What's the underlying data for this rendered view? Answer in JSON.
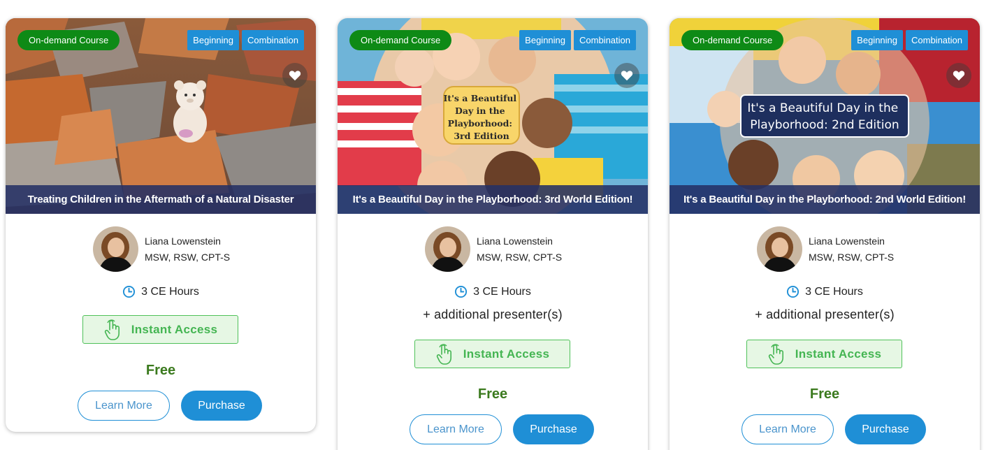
{
  "cards": [
    {
      "type_badge": "On-demand Course",
      "tags": [
        "Beginning",
        "Combination"
      ],
      "title": "Treating Children in the Aftermath of a Natural Disaster",
      "presenter_name": "Liana Lowenstein",
      "presenter_credentials": "MSW, RSW, CPT-S",
      "ce_hours": "3 CE Hours",
      "extra_presenters": "",
      "access_label": "Instant Access",
      "price": "Free",
      "learn_more_label": "Learn More",
      "purchase_label": "Purchase",
      "thumbnail_text": ""
    },
    {
      "type_badge": "On-demand Course",
      "tags": [
        "Beginning",
        "Combination"
      ],
      "title": "It's a Beautiful Day in the Playborhood: 3rd World Edition!",
      "presenter_name": "Liana Lowenstein",
      "presenter_credentials": "MSW, RSW, CPT-S",
      "ce_hours": "3 CE Hours",
      "extra_presenters": "+ additional presenter(s)",
      "access_label": "Instant Access",
      "price": "Free",
      "learn_more_label": "Learn More",
      "purchase_label": "Purchase",
      "thumbnail_text": [
        "It's a Beautiful",
        "Day in the",
        "Playborhood:",
        "3rd Edition"
      ]
    },
    {
      "type_badge": "On-demand Course",
      "tags": [
        "Beginning",
        "Combination"
      ],
      "title": "It's a Beautiful Day in the Playborhood: 2nd World Edition!",
      "presenter_name": "Liana Lowenstein",
      "presenter_credentials": "MSW, RSW, CPT-S",
      "ce_hours": "3 CE Hours",
      "extra_presenters": "+ additional presenter(s)",
      "access_label": "Instant Access",
      "price": "Free",
      "learn_more_label": "Learn More",
      "purchase_label": "Purchase",
      "thumbnail_text": [
        "It's a Beautiful Day in the",
        "Playborhood: 2nd Edition"
      ]
    }
  ],
  "colors": {
    "type_badge": "#0e8a16",
    "tag": "#1f8fd6",
    "title_bar": "#243064",
    "access_border": "#4fc159",
    "access_bg": "#e6f7e4",
    "price": "#3b7a1e",
    "primary_button": "#1f8fd6"
  },
  "icons": {
    "favorite": "heart-icon",
    "hours": "clock-icon",
    "access": "pointing-hand-icon"
  }
}
